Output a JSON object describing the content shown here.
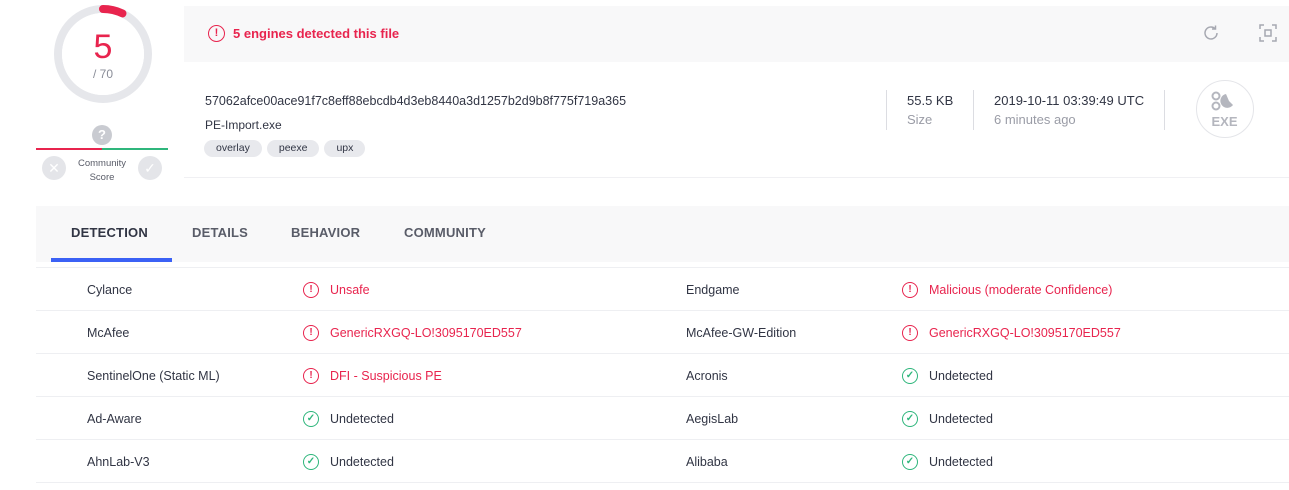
{
  "score": {
    "detected": "5",
    "total": "/ 70",
    "fraction": 0.0714
  },
  "community": {
    "label_line1": "Community",
    "label_line2": "Score",
    "question_glyph": "?"
  },
  "alert": {
    "text": "5 engines detected this file",
    "icon": "alert-circle-icon"
  },
  "file": {
    "hash": "57062afce00ace91f7c8eff88ebcdb4d3eb8440a3d1257b2d9b8f775f719a365",
    "name": "PE-Import.exe",
    "tags": [
      "overlay",
      "peexe",
      "upx"
    ],
    "size_value": "55.5 KB",
    "size_label": "Size",
    "date_value": "2019-10-11 03:39:49 UTC",
    "date_label": "6 minutes ago",
    "type_label": "EXE"
  },
  "tabs": [
    {
      "label": "DETECTION",
      "active": true
    },
    {
      "label": "DETAILS",
      "active": false
    },
    {
      "label": "BEHAVIOR",
      "active": false
    },
    {
      "label": "COMMUNITY",
      "active": false
    }
  ],
  "detections": [
    {
      "left": {
        "engine": "Cylance",
        "result": "Unsafe",
        "status": "bad"
      },
      "right": {
        "engine": "Endgame",
        "result": "Malicious (moderate Confidence)",
        "status": "bad"
      }
    },
    {
      "left": {
        "engine": "McAfee",
        "result": "GenericRXGQ-LO!3095170ED557",
        "status": "bad"
      },
      "right": {
        "engine": "McAfee-GW-Edition",
        "result": "GenericRXGQ-LO!3095170ED557",
        "status": "bad"
      }
    },
    {
      "left": {
        "engine": "SentinelOne (Static ML)",
        "result": "DFI - Suspicious PE",
        "status": "bad"
      },
      "right": {
        "engine": "Acronis",
        "result": "Undetected",
        "status": "ok"
      }
    },
    {
      "left": {
        "engine": "Ad-Aware",
        "result": "Undetected",
        "status": "ok"
      },
      "right": {
        "engine": "AegisLab",
        "result": "Undetected",
        "status": "ok"
      }
    },
    {
      "left": {
        "engine": "AhnLab-V3",
        "result": "Undetected",
        "status": "ok"
      },
      "right": {
        "engine": "Alibaba",
        "result": "Undetected",
        "status": "ok"
      }
    }
  ],
  "colors": {
    "malicious": "#e8244e",
    "clean": "#2fb67c",
    "accent": "#3b61f5"
  }
}
